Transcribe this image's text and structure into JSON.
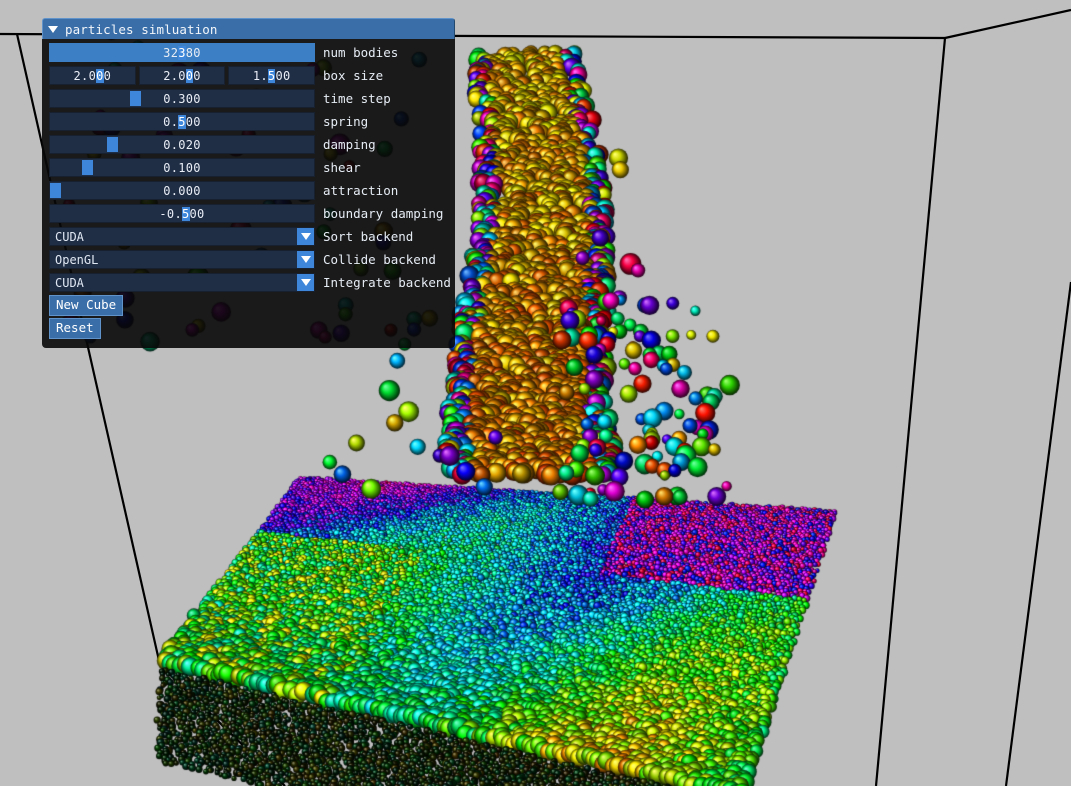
{
  "window": {
    "title": "particles simluation",
    "collapse_icon": "caret-down-icon"
  },
  "scene": {
    "background_color": "#bfbfbf",
    "wireframe_color": "#000000",
    "description": "CUDA particles demo: colored spheres falling into a dense particle bed inside a wireframe box"
  },
  "controls": [
    {
      "id": "num-bodies",
      "label": "num bodies",
      "type": "slider",
      "value": "32380",
      "cursor_index": 2,
      "fill": 1.0,
      "handle": null
    },
    {
      "id": "box-size",
      "label": "box size",
      "type": "slider-triple",
      "fields": [
        {
          "value": "2.000",
          "cursor_index": 3
        },
        {
          "value": "2.000",
          "cursor_index": 3
        },
        {
          "value": "1.500",
          "cursor_index": 2
        }
      ]
    },
    {
      "id": "time-step",
      "label": "time step",
      "type": "slider",
      "value": "0.300",
      "cursor_index": -1,
      "fill": 0,
      "handle": 0.315
    },
    {
      "id": "spring",
      "label": "spring",
      "type": "slider",
      "value": "0.500",
      "cursor_index": 2,
      "fill": 0,
      "handle": null
    },
    {
      "id": "damping",
      "label": "damping",
      "type": "slider",
      "value": "0.020",
      "cursor_index": -1,
      "fill": 0,
      "handle": 0.225
    },
    {
      "id": "shear",
      "label": "shear",
      "type": "slider",
      "value": "0.100",
      "cursor_index": -1,
      "fill": 0,
      "handle": 0.125
    },
    {
      "id": "attraction",
      "label": "attraction",
      "type": "slider",
      "value": "0.000",
      "cursor_index": -1,
      "fill": 0,
      "handle": 0.0
    },
    {
      "id": "boundary-damping",
      "label": "boundary damping",
      "type": "slider",
      "value": "-0.500",
      "cursor_index": 3,
      "fill": 0,
      "handle": null
    },
    {
      "id": "sort-backend",
      "label": "Sort backend",
      "type": "combo",
      "value": "CUDA"
    },
    {
      "id": "collide-backend",
      "label": "Collide backend",
      "type": "combo",
      "value": "OpenGL"
    },
    {
      "id": "integrate-backend",
      "label": "Integrate backend",
      "type": "combo",
      "value": "CUDA"
    }
  ],
  "buttons": [
    {
      "id": "new-cube",
      "label": "New Cube"
    },
    {
      "id": "reset",
      "label": "Reset"
    }
  ],
  "colors": {
    "titlebar": "#3a6ea8",
    "slider_track": "#1f2d45",
    "slider_fill": "#3d86da",
    "panel_bg": "#080808",
    "text": "#e6ecf4"
  }
}
